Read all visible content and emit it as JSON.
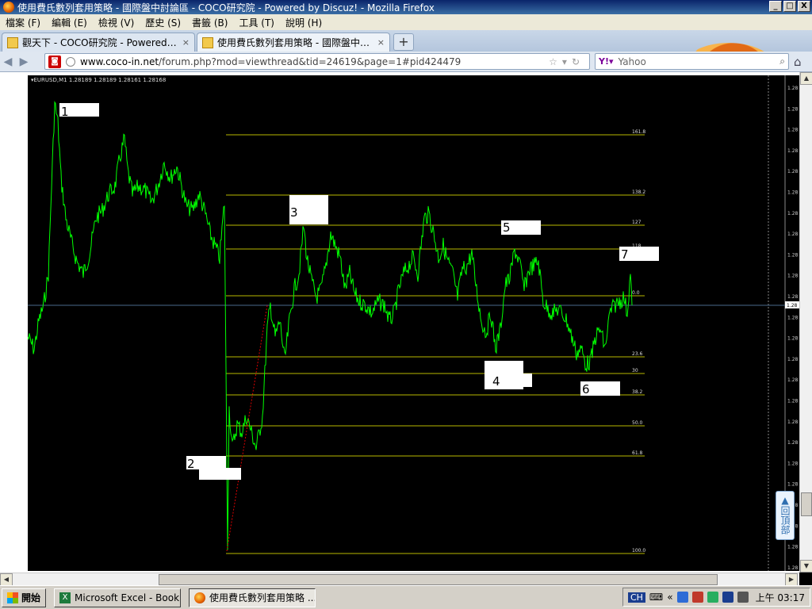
{
  "window": {
    "title": "使用費氏數列套用策略 - 國際盤中討論區 - COCO研究院 - Powered by Discuz! - Mozilla Firefox",
    "buttons": [
      "_",
      "□",
      "X"
    ]
  },
  "menu": [
    "檔案 (F)",
    "編輯 (E)",
    "檢視 (V)",
    "歷史 (S)",
    "書籤 (B)",
    "工具 (T)",
    "說明 (H)"
  ],
  "tabs": [
    {
      "label": "觀天下 - COCO研究院 - Powered by Di…",
      "active": false
    },
    {
      "label": "使用費氏數列套用策略 - 國際盤中討…",
      "active": true
    }
  ],
  "newtab_label": "+",
  "tab_close_label": "×",
  "navbar": {
    "url_host": "www.coco-in.net",
    "url_path": "/forum.php?mod=viewthread&tid=24619&page=1#pid424479",
    "search_placeholder": "Yahoo"
  },
  "chart": {
    "header": "▾EURUSD,M1  1.28189 1.28189 1.28161 1.28168",
    "fib_levels": [
      "161.8",
      "138.2",
      "127",
      "118",
      "0.0",
      "23.6",
      "30",
      "38.2",
      "50.0",
      "61.8",
      "100.0"
    ],
    "price_label": "1.28",
    "current_price_label": "1.28",
    "point_labels": [
      "1",
      "2",
      "3",
      "4",
      "5",
      "6",
      "7"
    ]
  },
  "backtop_label": "回頂部",
  "taskbar": {
    "start_label": "開始",
    "apps": [
      {
        "label": "Microsoft Excel - Book1",
        "icon": "excel-icon",
        "active": false
      },
      {
        "label": "使用費氏數列套用策略 ...",
        "icon": "firefox-icon",
        "active": true
      }
    ],
    "lang": "CH",
    "clock": "上午 03:17",
    "tray_colors": [
      "#2d6bd6",
      "#c0392b",
      "#27ae60",
      "#1a3d8f",
      "#555555"
    ]
  },
  "colors": {
    "chart_bg": "#000000",
    "price_line": "#00ff00",
    "fib_line": "#b8b800",
    "crosshair": "#4a6a8a"
  }
}
